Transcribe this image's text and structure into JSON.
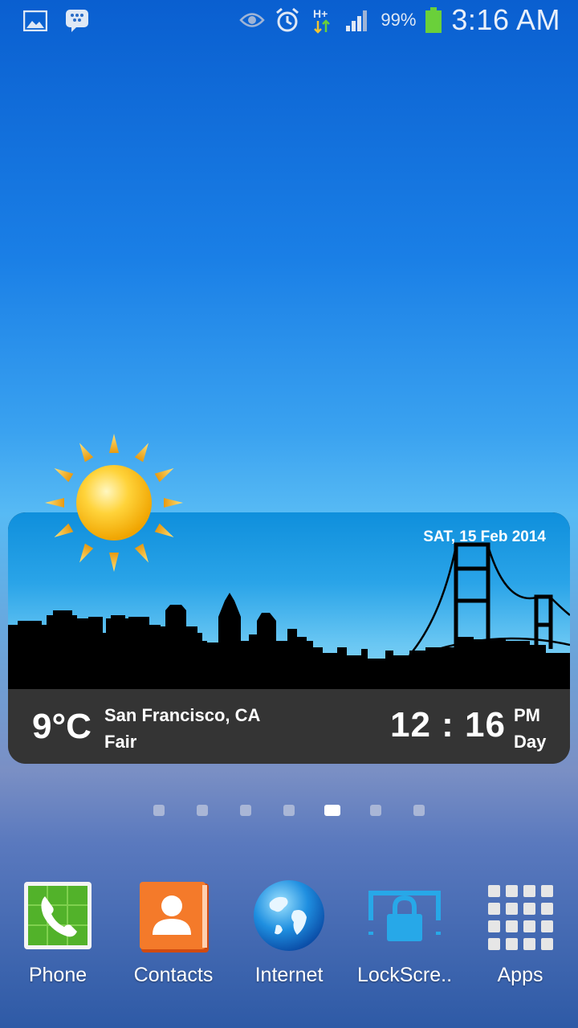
{
  "status_bar": {
    "left_icons": [
      "gallery-icon",
      "bbm-icon"
    ],
    "right_icons": [
      "eye-icon",
      "alarm-icon",
      "hplus-data-icon",
      "signal-icon",
      "battery-icon"
    ],
    "network_type": "H+",
    "battery": "99%",
    "time": "3:16 AM"
  },
  "weather_widget": {
    "date": "SAT, 15 Feb 2014",
    "temperature": "9°C",
    "city": "San Francisco, CA",
    "condition": "Fair",
    "time": "12 : 16",
    "ampm": "PM",
    "period": "Day",
    "icon": "sun-icon"
  },
  "page_indicator": {
    "count": 7,
    "active_index": 4
  },
  "dock": {
    "apps": [
      {
        "label": "Phone",
        "icon": "phone-icon"
      },
      {
        "label": "Contacts",
        "icon": "contacts-icon"
      },
      {
        "label": "Internet",
        "icon": "globe-icon"
      },
      {
        "label": "LockScre..",
        "icon": "lockscreen-icon"
      },
      {
        "label": "Apps",
        "icon": "apps-grid-icon"
      }
    ]
  },
  "colors": {
    "battery": "#6ad03a",
    "widget_bar": "#343434"
  }
}
